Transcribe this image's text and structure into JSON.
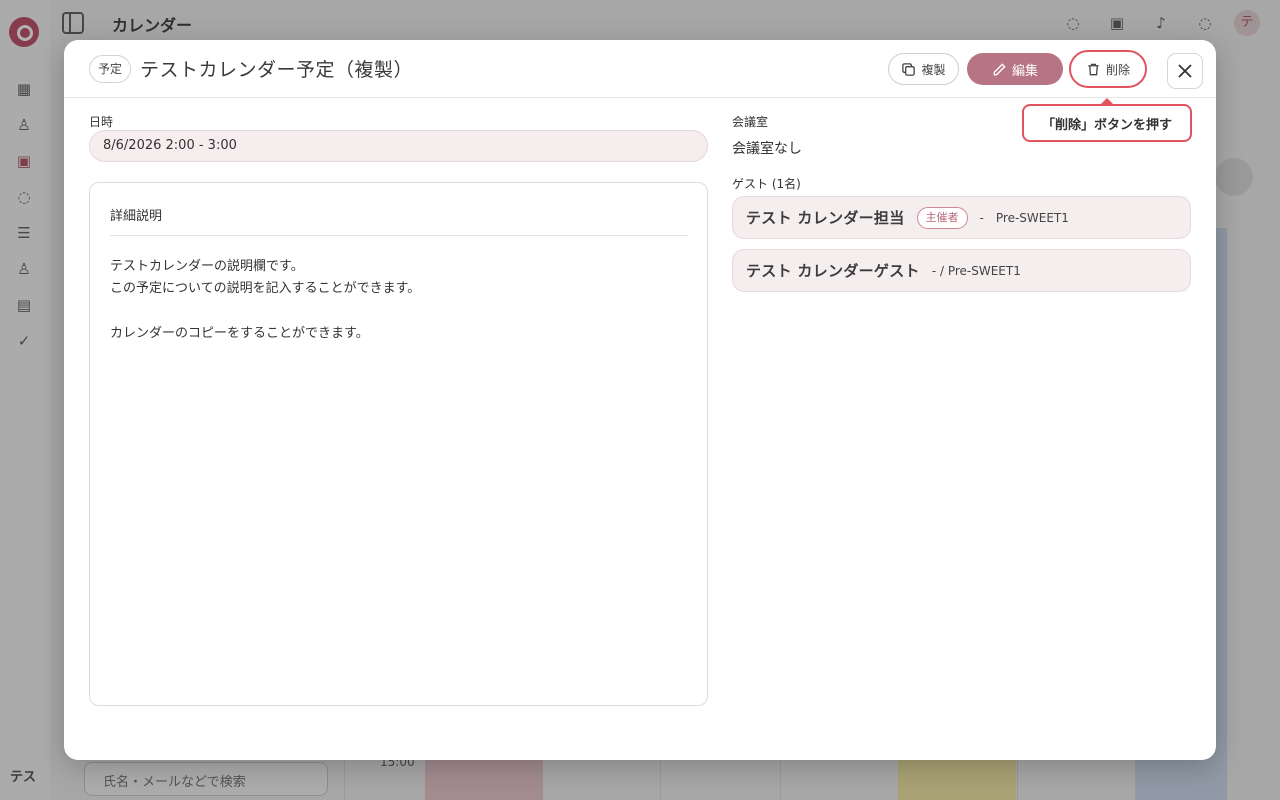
{
  "background": {
    "app_title": "カレンダー",
    "user_initials": "テス",
    "avatar_letter": "テ",
    "time_label": "15:00",
    "search_placeholder": "氏名・メールなどで検索"
  },
  "modal": {
    "type_badge": "予定",
    "title": "テストカレンダー予定（複製）",
    "buttons": {
      "copy": "複製",
      "edit": "編集",
      "delete": "削除",
      "close_icon": "close-icon"
    },
    "tooltip": "「削除」ボタンを押す",
    "datetime": {
      "label": "日時",
      "value": "8/6/2026 2:00 - 3:00"
    },
    "description": {
      "title": "詳細説明",
      "lines": [
        "テストカレンダーの説明欄です。",
        "この予定についての説明を記入することができます。",
        "",
        "カレンダーのコピーをすることができます。"
      ]
    },
    "room": {
      "label": "会議室",
      "value": "会議室なし"
    },
    "guests": {
      "label": "ゲスト (1名)",
      "items": [
        {
          "name": "テスト カレンダー担当",
          "badge": "主催者",
          "dash": "-",
          "org": "Pre-SWEET1"
        },
        {
          "name": "テスト カレンダーゲスト",
          "meta": "- / Pre-SWEET1"
        }
      ]
    }
  },
  "colors": {
    "accent": "#b77484",
    "highlight": "#e05460",
    "field_bg": "#f5edee"
  }
}
